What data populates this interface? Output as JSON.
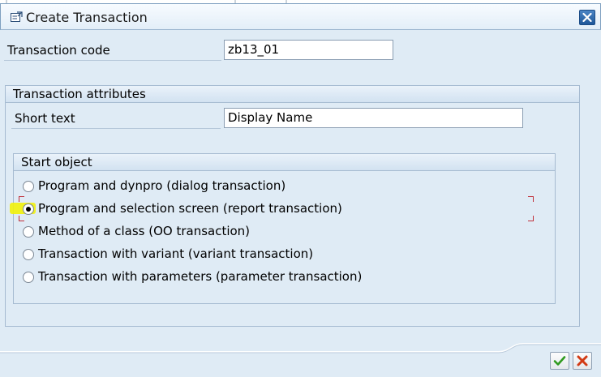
{
  "window": {
    "title": "Create Transaction"
  },
  "transaction_code": {
    "label": "Transaction code",
    "value": "zb13_01"
  },
  "attributes": {
    "title": "Transaction attributes",
    "short_text_label": "Short text",
    "short_text_value": "Display Name"
  },
  "start_object": {
    "title": "Start object",
    "options": [
      {
        "label": "Program and dynpro (dialog transaction)",
        "selected": false
      },
      {
        "label": "Program and selection screen (report transaction)",
        "selected": true
      },
      {
        "label": "Method of a class (OO transaction)",
        "selected": false
      },
      {
        "label": "Transaction with variant (variant transaction)",
        "selected": false
      },
      {
        "label": "Transaction with parameters (parameter transaction)",
        "selected": false
      }
    ]
  },
  "footer": {
    "confirm_icon": "check-icon",
    "cancel_icon": "cancel-x-icon"
  },
  "colors": {
    "background": "#dfebf5",
    "close_button": "#1e5799",
    "confirm_green": "#2e9a1e",
    "cancel_red": "#d23a14",
    "highlight": "#f2f20a",
    "focus_corner": "#c0303a"
  }
}
